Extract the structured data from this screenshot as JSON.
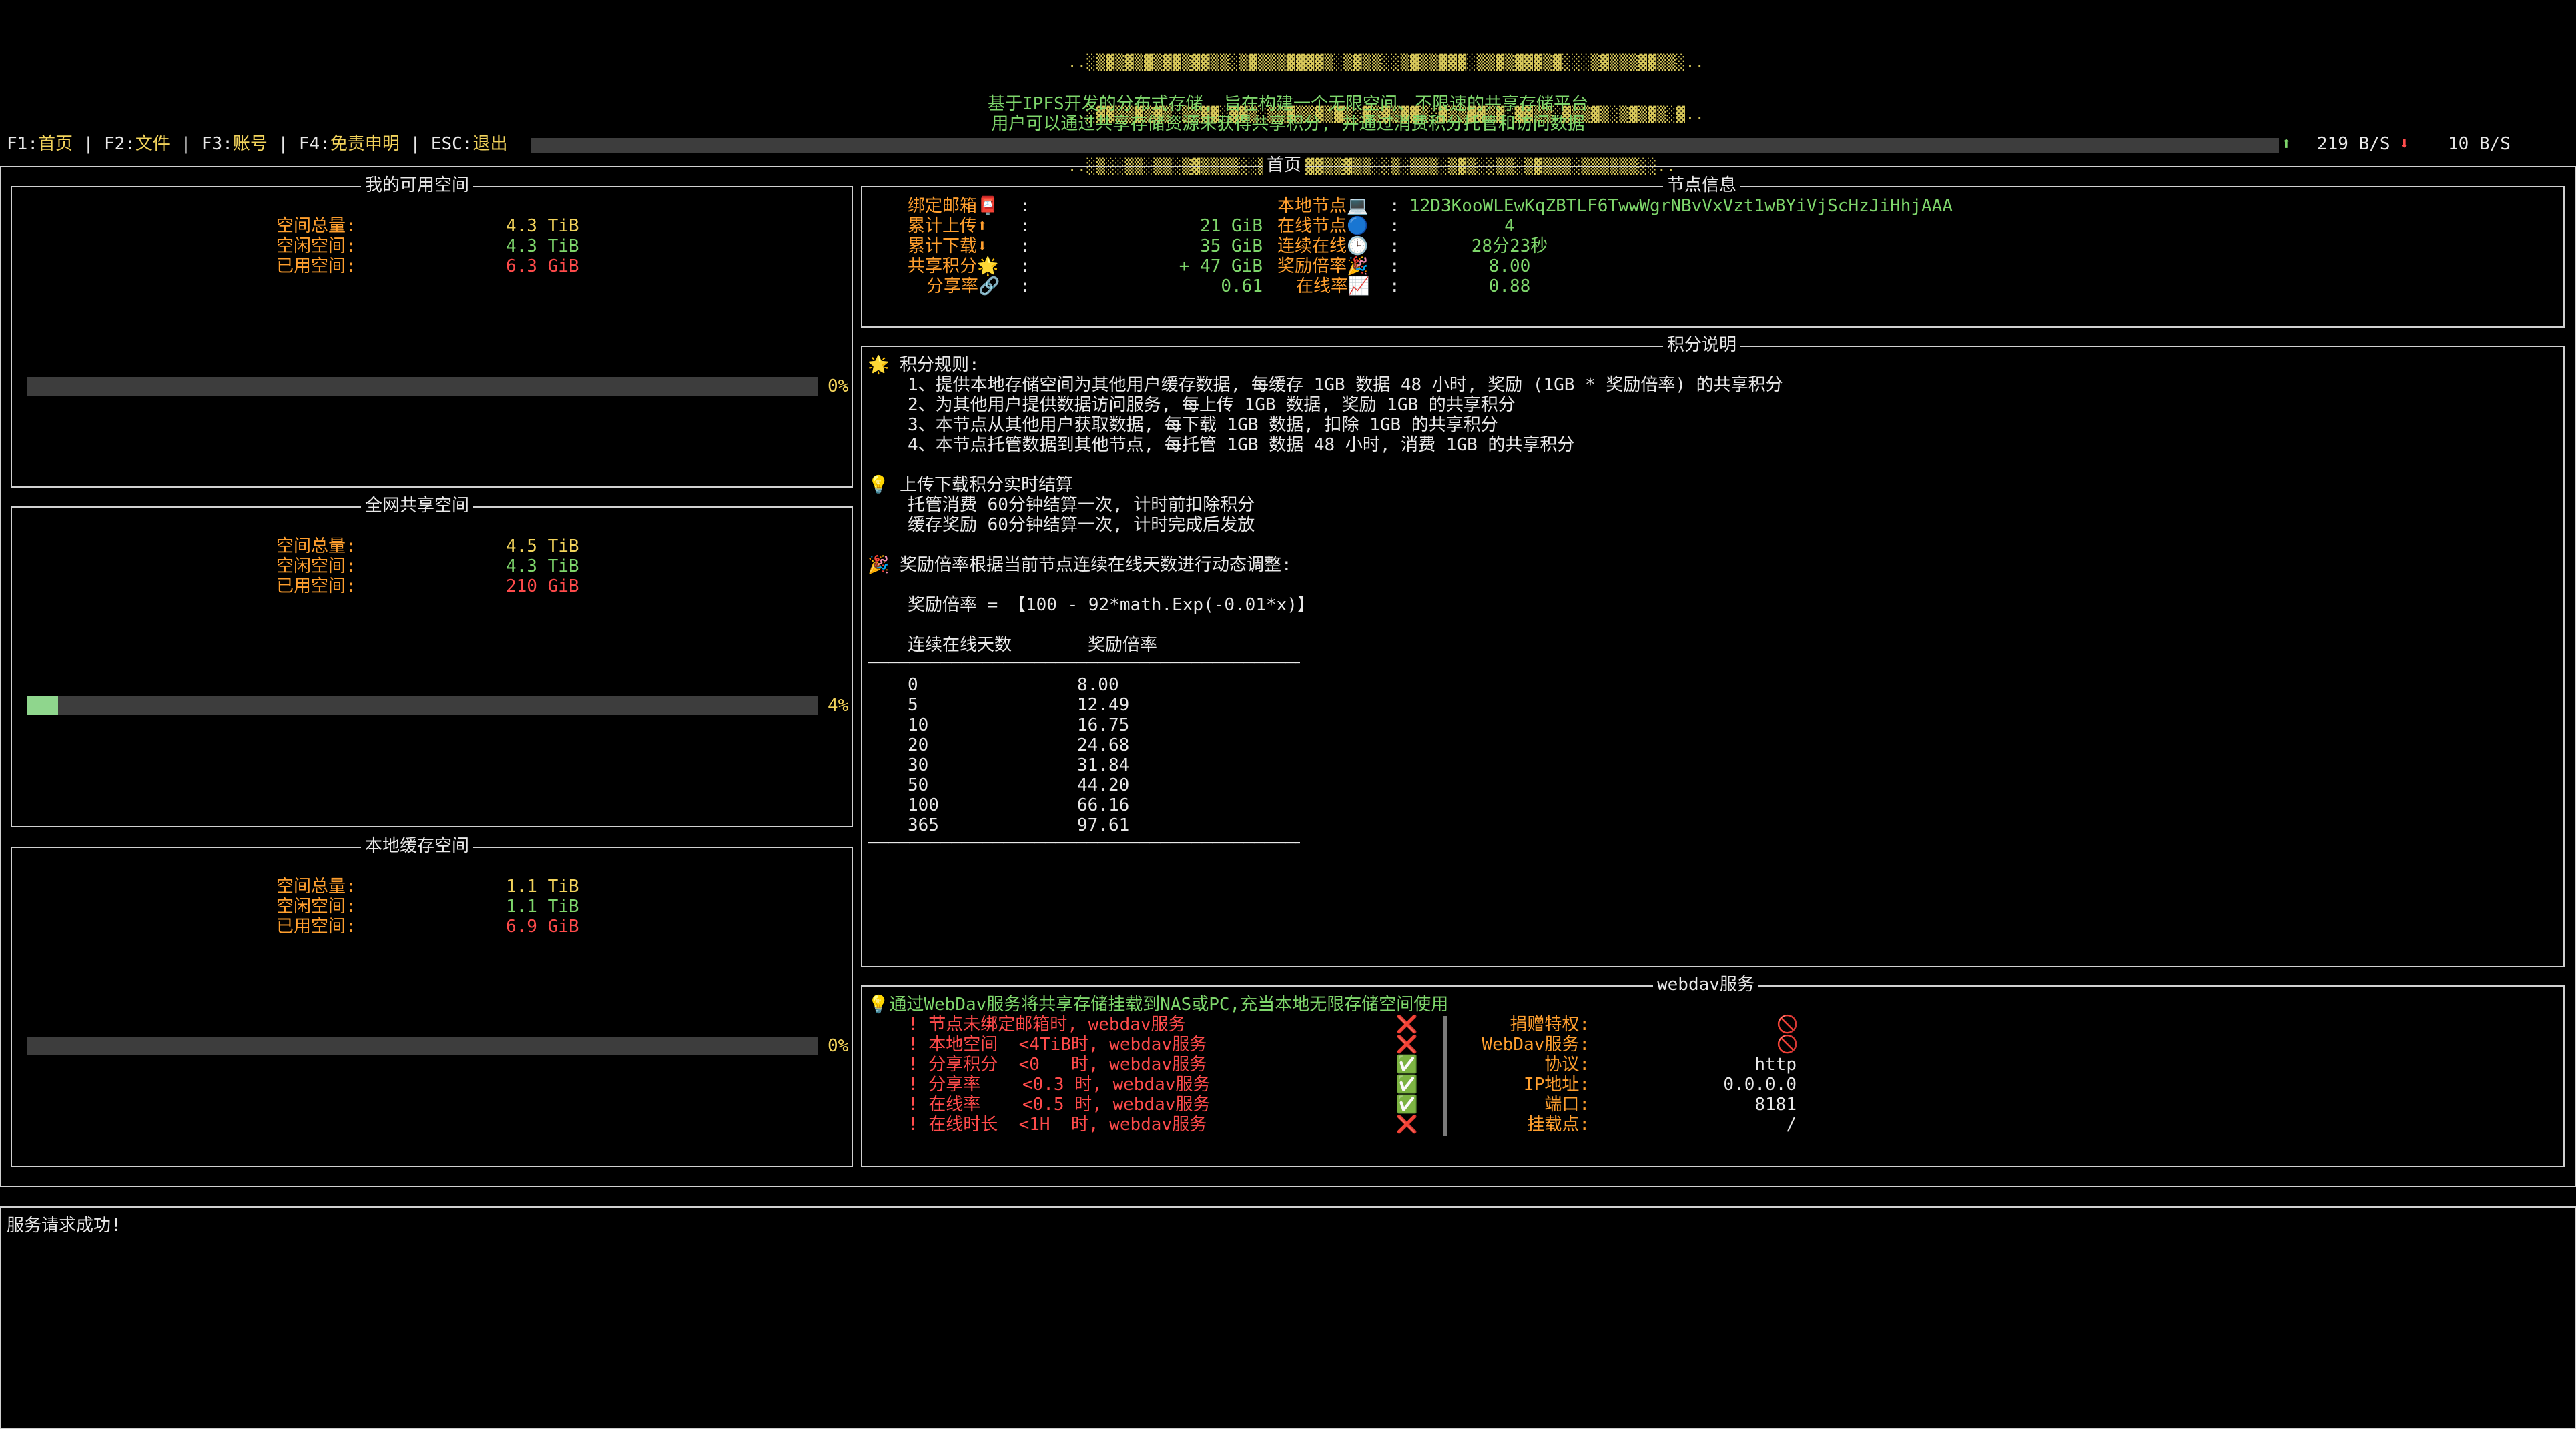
{
  "banner": {
    "ascii_lines": [
      "..░▒▓▒▓▒▓▒▓▓▒▓▓▒▒░▒▓▒▒▒▓▓▓▓▒░▒▓▒▒░░▒▓▒▒▓▓▓░▒▒▓▒▓▓▓▒▓░░░▒▓▒▒▒▓▓▒▒░..",
      "..░▓▓▒▒▓▒▓▒░▒▒▓▓░▓▓▒░▒▒▓▒▒▓▒▓▒░▓▒▓▒▓▓▒░▓▒▒▓▓▒▓░▓▓▒▒░▓▒▒▓▒░▒▓▒▓▒░▓..",
      "..░▒░░▒▒░▒▒░▒▓▒▒▒▒░░▒▓▒▒▒▓▓▒▒▓▒▒░░▒░▒▒▒░▒▓▒░░▒▒░▒▓▒▒▒░▒▒▒▒▒▒░░.."
    ],
    "tagline1": "基于IPFS开发的分布式存储, 旨在构建一个无限空间、不限速的共享存储平台",
    "tagline2": "用户可以通过共享存储资源来获得共享积分, 并通过消费积分托管和访问数据"
  },
  "menu": [
    {
      "key": "F1",
      "label": "首页"
    },
    {
      "key": "F2",
      "label": "文件"
    },
    {
      "key": "F3",
      "label": "账号"
    },
    {
      "key": "F4",
      "label": "免责申明"
    },
    {
      "key": "ESC",
      "label": "退出"
    }
  ],
  "speed": {
    "up": "219 B/S",
    "down": "10 B/S",
    "up_icon": "arrow-up-icon",
    "down_icon": "arrow-down-icon"
  },
  "page_title": "首页",
  "space_panels": [
    {
      "title": "我的可用空间",
      "total_label": "空间总量",
      "total": "4.3 TiB",
      "free_label": "空闲空间",
      "free": "4.3 TiB",
      "used_label": "已用空间",
      "used": "6.3 GiB",
      "percent": 0,
      "percent_text": "0%"
    },
    {
      "title": "全网共享空间",
      "total_label": "空间总量",
      "total": "4.5 TiB",
      "free_label": "空闲空间",
      "free": "4.3 TiB",
      "used_label": "已用空间",
      "used": "210 GiB",
      "percent": 4,
      "percent_text": "4%"
    },
    {
      "title": "本地缓存空间",
      "total_label": "空间总量",
      "total": "1.1 TiB",
      "free_label": "空闲空间",
      "free": "1.1 TiB",
      "used_label": "已用空间",
      "used": "6.9 GiB",
      "percent": 0,
      "percent_text": "0%"
    }
  ],
  "node_info": {
    "title": "节点信息",
    "left": [
      {
        "label": "绑定邮箱📮",
        "value": ""
      },
      {
        "label": "累计上传⬆",
        "value": "21 GiB"
      },
      {
        "label": "累计下载⬇",
        "value": "35 GiB"
      },
      {
        "label": "共享积分🌟",
        "value": "+ 47 GiB"
      },
      {
        "label": "分享率🔗",
        "value": "0.61"
      }
    ],
    "right": [
      {
        "label": "本地节点💻",
        "value": "12D3KooWLEwKqZBTLF6TwwWgrNBvVxVzt1wBYiVjScHzJiHhjAAA"
      },
      {
        "label": "在线节点🔵",
        "value": "4"
      },
      {
        "label": "连续在线🕒",
        "value": "28分23秒"
      },
      {
        "label": "奖励倍率🎉",
        "value": "8.00"
      },
      {
        "label": "在线率📈",
        "value": "0.88"
      }
    ]
  },
  "score_info": {
    "title": "积分说明",
    "rules_header": "🌟 积分规则:",
    "rules": [
      "1、提供本地存储空间为其他用户缓存数据, 每缓存 1GB 数据 48 小时, 奖励 (1GB * 奖励倍率) 的共享积分",
      "2、为其他用户提供数据访问服务, 每上传 1GB 数据, 奖励 1GB 的共享积分",
      "3、本节点从其他用户获取数据, 每下载 1GB 数据, 扣除 1GB 的共享积分",
      "4、本节点托管数据到其他节点, 每托管 1GB 数据 48 小时, 消费 1GB 的共享积分"
    ],
    "settle_header": "💡 上传下载积分实时结算",
    "settle": [
      "托管消费 60分钟结算一次, 计时前扣除积分",
      "缓存奖励 60分钟结算一次, 计时完成后发放"
    ],
    "ratio_header": "🎉 奖励倍率根据当前节点连续在线天数进行动态调整:",
    "formula": "奖励倍率 = 【100 - 92*math.Exp(-0.01*x)】",
    "table_headers": [
      "连续在线天数",
      "奖励倍率"
    ],
    "table_rule": "──────────────────────────────────────────────",
    "table": [
      [
        "0",
        "8.00"
      ],
      [
        "5",
        "12.49"
      ],
      [
        "10",
        "16.75"
      ],
      [
        "20",
        "24.68"
      ],
      [
        "30",
        "31.84"
      ],
      [
        "50",
        "44.20"
      ],
      [
        "100",
        "66.16"
      ],
      [
        "365",
        "97.61"
      ]
    ]
  },
  "webdav": {
    "title": "webdav服务",
    "intro": "💡通过WebDav服务将共享存储挂载到NAS或PC,充当本地无限存储空间使用",
    "conditions": [
      {
        "text": "! 节点未绑定邮箱时, webdav服务",
        "status": "❌",
        "status_name": "cross-icon"
      },
      {
        "text": "! 本地空间  <4TiB时, webdav服务",
        "status": "❌",
        "status_name": "cross-icon"
      },
      {
        "text": "! 分享积分  <0   时, webdav服务",
        "status": "✅",
        "status_name": "check-icon"
      },
      {
        "text": "! 分享率    <0.3 时, webdav服务",
        "status": "✅",
        "status_name": "check-icon"
      },
      {
        "text": "! 在线率    <0.5 时, webdav服务",
        "status": "✅",
        "status_name": "check-icon"
      },
      {
        "text": "! 在线时长  <1H  时, webdav服务",
        "status": "❌",
        "status_name": "cross-icon"
      }
    ],
    "props": [
      {
        "label": "捐赠特权:",
        "value": "🚫"
      },
      {
        "label": "WebDav服务:",
        "value": "🚫"
      },
      {
        "label": "协议:",
        "value": "http"
      },
      {
        "label": "IP地址:",
        "value": "0.0.0.0"
      },
      {
        "label": "端口:",
        "value": "8181"
      },
      {
        "label": "挂载点:",
        "value": "/"
      }
    ]
  },
  "status_message": "服务请求成功!"
}
